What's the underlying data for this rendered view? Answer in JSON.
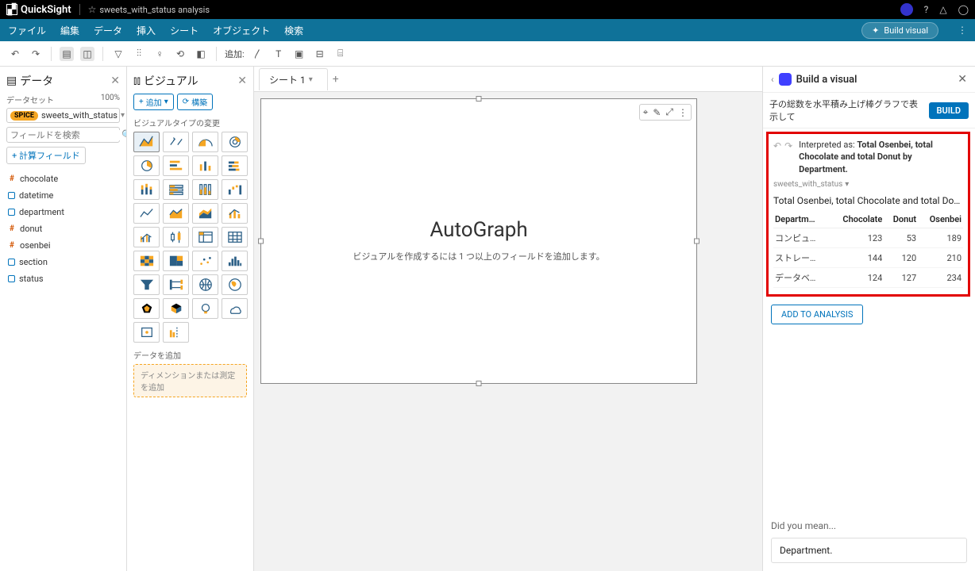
{
  "topbar": {
    "product": "QuickSight",
    "analysis_name": "sweets_with_status analysis"
  },
  "menubar": {
    "items": [
      "ファイル",
      "編集",
      "データ",
      "挿入",
      "シート",
      "オブジェクト",
      "検索"
    ],
    "build_visual": "Build visual"
  },
  "toolbar": {
    "add_label": "追加:"
  },
  "data_panel": {
    "title": "データ",
    "dataset_label": "データセット",
    "dataset_pct": "100%",
    "spice": "SPICE",
    "dataset_name": "sweets_with_status",
    "search_placeholder": "フィールドを検索",
    "calc_field": "計算フィールド",
    "fields": [
      {
        "type": "hash",
        "name": "chocolate"
      },
      {
        "type": "box",
        "name": "datetime"
      },
      {
        "type": "box",
        "name": "department"
      },
      {
        "type": "hash",
        "name": "donut"
      },
      {
        "type": "hash",
        "name": "osenbei"
      },
      {
        "type": "box",
        "name": "section"
      },
      {
        "type": "box",
        "name": "status"
      }
    ]
  },
  "visual_panel": {
    "title": "ビジュアル",
    "add": "追加",
    "structure": "構築",
    "type_label": "ビジュアルタイプの変更",
    "data_add_label": "データを追加",
    "dropzone": "ディメンションまたは測定を追加"
  },
  "sheets": {
    "active": "シート 1"
  },
  "canvas": {
    "title": "AutoGraph",
    "subtitle": "ビジュアルを作成するには 1 つ以上のフィールドを追加します。"
  },
  "right_panel": {
    "header": "Build a visual",
    "prompt_text": "子の総数を水平積み上げ棒グラフで表示して",
    "build": "BUILD",
    "interpreted_prefix": "Interpreted as: ",
    "interpreted_bold": "Total Osenbei, total Chocolate and total Donut by Department.",
    "source": "sweets_with_status",
    "result_title": "Total Osenbei, total Chocolate and total Donut by De…",
    "columns": [
      "Departm…",
      "Chocolate",
      "Donut",
      "Osenbei"
    ],
    "rows": [
      {
        "dept": "コンピュ…",
        "chocolate": 123,
        "donut": 53,
        "osenbei": 189
      },
      {
        "dept": "ストレー…",
        "chocolate": 144,
        "donut": 120,
        "osenbei": 210
      },
      {
        "dept": "データベ…",
        "chocolate": 124,
        "donut": 127,
        "osenbei": 234
      }
    ],
    "add_to_analysis": "ADD TO ANALYSIS",
    "did_you_mean": "Did you mean...",
    "suggestion": "Department."
  },
  "chart_data": {
    "type": "table",
    "title": "Total Osenbei, total Chocolate and total Donut by Department",
    "columns": [
      "Department",
      "Chocolate",
      "Donut",
      "Osenbei"
    ],
    "rows": [
      [
        "コンピュ…",
        123,
        53,
        189
      ],
      [
        "ストレー…",
        144,
        120,
        210
      ],
      [
        "データベ…",
        124,
        127,
        234
      ]
    ]
  }
}
